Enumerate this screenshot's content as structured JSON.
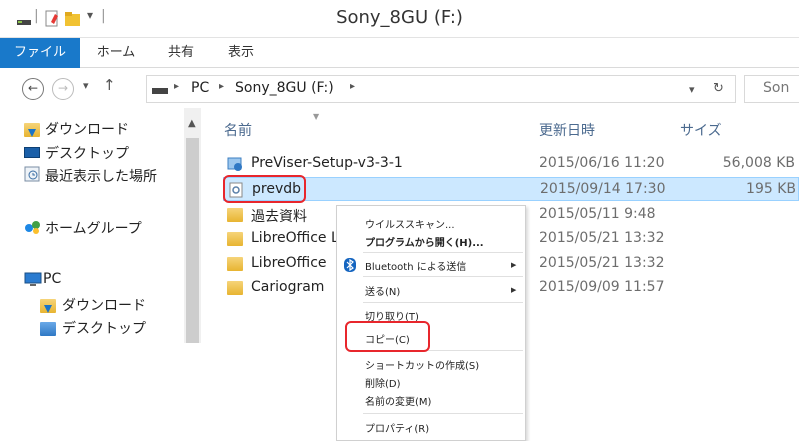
{
  "window": {
    "title": "Sony_8GU (F:)"
  },
  "ribbon": {
    "tabs": [
      "ファイル",
      "ホーム",
      "共有",
      "表示"
    ]
  },
  "address": {
    "crumbs": [
      "PC",
      "Sony_8GU (F:)"
    ],
    "search_placeholder": "Son"
  },
  "nav": {
    "items": [
      {
        "label": "ダウンロード",
        "icon": "download-folder-icon"
      },
      {
        "label": "デスクトップ",
        "icon": "desktop-icon"
      },
      {
        "label": "最近表示した場所",
        "icon": "recent-places-icon"
      },
      {
        "label": "ホームグループ",
        "icon": "homegroup-icon"
      },
      {
        "label": "PC",
        "icon": "pc-icon"
      },
      {
        "label": "ダウンロード",
        "icon": "download-folder-icon"
      },
      {
        "label": "デスクトップ",
        "icon": "desktop-folder-icon"
      }
    ]
  },
  "columns": {
    "name": "名前",
    "date": "更新日時",
    "size": "サイズ"
  },
  "files": [
    {
      "name": "PreViser-Setup-v3-3-1",
      "date": "2015/06/16 11:20",
      "size": "56,008 KB",
      "icon": "installer-icon"
    },
    {
      "name": "prevdb",
      "date": "2015/09/14 17:30",
      "size": "195 KB",
      "icon": "data-file-icon",
      "selected": true
    },
    {
      "name": "過去資料",
      "date": "2015/05/11 9:48",
      "size": "",
      "icon": "folder-icon"
    },
    {
      "name": "LibreOffice L",
      "date": "2015/05/21 13:32",
      "size": "",
      "icon": "folder-icon"
    },
    {
      "name": "LibreOffice",
      "date": "2015/05/21 13:32",
      "size": "",
      "icon": "folder-icon"
    },
    {
      "name": "Cariogram",
      "date": "2015/09/09 11:57",
      "size": "",
      "icon": "folder-icon"
    }
  ],
  "context_menu": {
    "virus_scan": "ウイルススキャン...",
    "open_with": "プログラムから開く(H)...",
    "bluetooth": "Bluetooth による送信",
    "send_to": "送る(N)",
    "cut": "切り取り(T)",
    "copy": "コピー(C)",
    "create_shortcut": "ショートカットの作成(S)",
    "delete": "削除(D)",
    "rename": "名前の変更(M)",
    "properties": "プロパティ(R)"
  },
  "colors": {
    "accent": "#1979ca",
    "selection": "#cce8ff",
    "highlight": "#e8262c"
  }
}
